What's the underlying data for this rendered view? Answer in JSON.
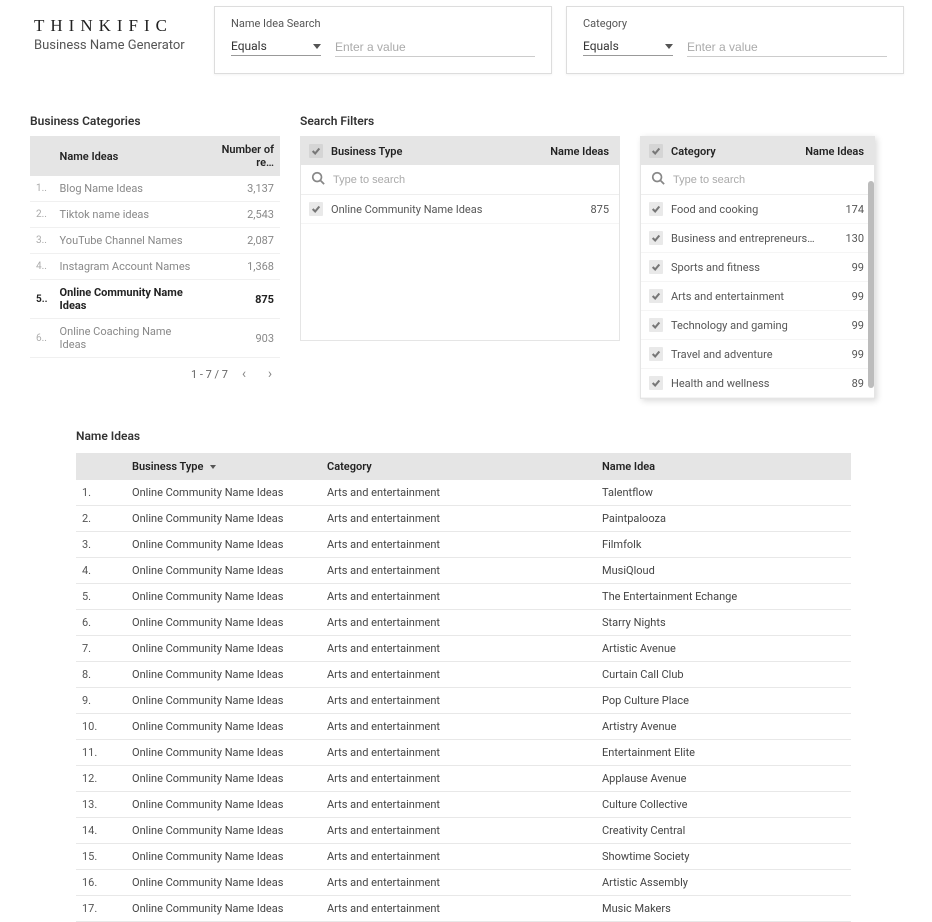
{
  "brand": {
    "logo": "THINKIFIC",
    "subtitle": "Business Name Generator"
  },
  "search": {
    "name_idea": {
      "label": "Name Idea Search",
      "operator": "Equals",
      "placeholder": "Enter a value"
    },
    "category": {
      "label": "Category",
      "operator": "Equals",
      "placeholder": "Enter a value"
    }
  },
  "biz_categories": {
    "title": "Business Categories",
    "cols": {
      "name": "Name Ideas",
      "count": "Number of re…"
    },
    "rows": [
      {
        "idx": "1..",
        "name": "Blog Name Ideas",
        "count": "3,137",
        "selected": false
      },
      {
        "idx": "2..",
        "name": "Tiktok name ideas",
        "count": "2,543",
        "selected": false
      },
      {
        "idx": "3..",
        "name": "YouTube Channel Names",
        "count": "2,087",
        "selected": false
      },
      {
        "idx": "4..",
        "name": "Instagram Account Names",
        "count": "1,368",
        "selected": false
      },
      {
        "idx": "5..",
        "name": "Online Community Name Ideas",
        "count": "875",
        "selected": true
      },
      {
        "idx": "6..",
        "name": "Online Coaching Name Ideas",
        "count": "903",
        "selected": false
      }
    ],
    "pager": "1 - 7 / 7"
  },
  "filters_title": "Search Filters",
  "business_type_filter": {
    "header": {
      "name": "Business Type",
      "count": "Name Ideas"
    },
    "search_placeholder": "Type to search",
    "rows": [
      {
        "name": "Online Community Name Ideas",
        "count": "875"
      }
    ]
  },
  "category_filter": {
    "header": {
      "name": "Category",
      "count": "Name Ideas"
    },
    "search_placeholder": "Type to search",
    "rows": [
      {
        "name": "Food and cooking",
        "count": "174"
      },
      {
        "name": "Business and entrepreneurs…",
        "count": "130"
      },
      {
        "name": "Sports and fitness",
        "count": "99"
      },
      {
        "name": "Arts and entertainment",
        "count": "99"
      },
      {
        "name": "Technology and gaming",
        "count": "99"
      },
      {
        "name": "Travel and adventure",
        "count": "99"
      },
      {
        "name": "Health and wellness",
        "count": "89"
      }
    ]
  },
  "name_ideas": {
    "title": "Name Ideas",
    "cols": {
      "biz": "Business Type",
      "cat": "Category",
      "idea": "Name Idea"
    },
    "rows": [
      {
        "idx": "1.",
        "biz": "Online Community Name Ideas",
        "cat": "Arts and entertainment",
        "idea": "Talentflow"
      },
      {
        "idx": "2.",
        "biz": "Online Community Name Ideas",
        "cat": "Arts and entertainment",
        "idea": "Paintpalooza"
      },
      {
        "idx": "3.",
        "biz": "Online Community Name Ideas",
        "cat": "Arts and entertainment",
        "idea": "Filmfolk"
      },
      {
        "idx": "4.",
        "biz": "Online Community Name Ideas",
        "cat": "Arts and entertainment",
        "idea": "MusiQloud"
      },
      {
        "idx": "5.",
        "biz": "Online Community Name Ideas",
        "cat": "Arts and entertainment",
        "idea": "The Entertainment Echange"
      },
      {
        "idx": "6.",
        "biz": "Online Community Name Ideas",
        "cat": "Arts and entertainment",
        "idea": "Starry Nights"
      },
      {
        "idx": "7.",
        "biz": "Online Community Name Ideas",
        "cat": "Arts and entertainment",
        "idea": "Artistic Avenue"
      },
      {
        "idx": "8.",
        "biz": "Online Community Name Ideas",
        "cat": "Arts and entertainment",
        "idea": "Curtain Call Club"
      },
      {
        "idx": "9.",
        "biz": "Online Community Name Ideas",
        "cat": "Arts and entertainment",
        "idea": "Pop Culture Place"
      },
      {
        "idx": "10.",
        "biz": "Online Community Name Ideas",
        "cat": "Arts and entertainment",
        "idea": "Artistry Avenue"
      },
      {
        "idx": "11.",
        "biz": "Online Community Name Ideas",
        "cat": "Arts and entertainment",
        "idea": "Entertainment Elite"
      },
      {
        "idx": "12.",
        "biz": "Online Community Name Ideas",
        "cat": "Arts and entertainment",
        "idea": "Applause Avenue"
      },
      {
        "idx": "13.",
        "biz": "Online Community Name Ideas",
        "cat": "Arts and entertainment",
        "idea": "Culture Collective"
      },
      {
        "idx": "14.",
        "biz": "Online Community Name Ideas",
        "cat": "Arts and entertainment",
        "idea": "Creativity Central"
      },
      {
        "idx": "15.",
        "biz": "Online Community Name Ideas",
        "cat": "Arts and entertainment",
        "idea": "Showtime Society"
      },
      {
        "idx": "16.",
        "biz": "Online Community Name Ideas",
        "cat": "Arts and entertainment",
        "idea": "Artistic Assembly"
      },
      {
        "idx": "17.",
        "biz": "Online Community Name Ideas",
        "cat": "Arts and entertainment",
        "idea": "Music Makers"
      }
    ]
  }
}
